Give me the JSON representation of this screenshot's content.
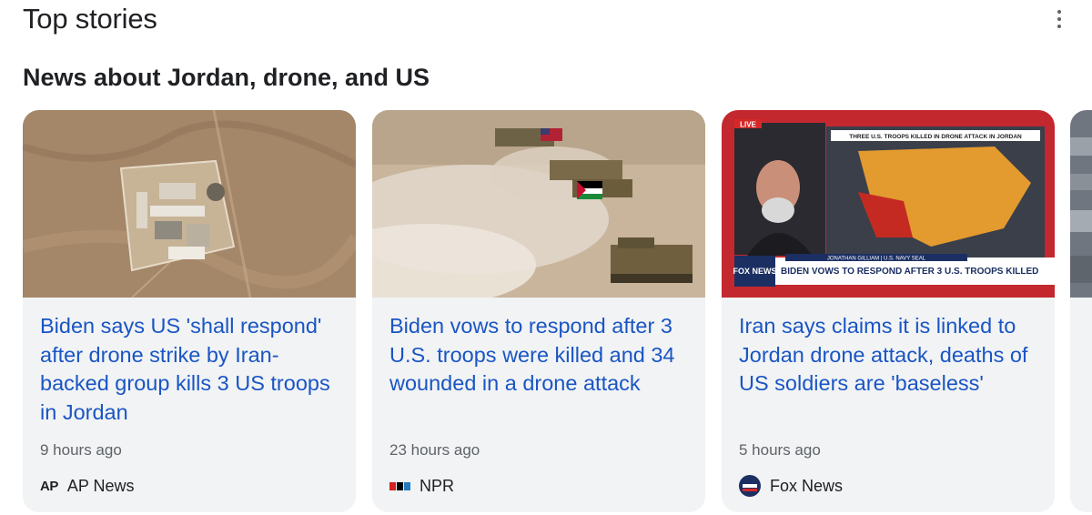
{
  "header": {
    "title": "Top stories",
    "more_icon": "more-vert-icon"
  },
  "section": {
    "title": "News about Jordan, drone, and US"
  },
  "cards": [
    {
      "headline": "Biden says US 'shall respond' after drone strike by Iran-backed group kills 3 US troops in Jordan",
      "time": "9 hours ago",
      "source": "AP News",
      "logo_text": "AP",
      "image": "satellite view of military outpost"
    },
    {
      "headline": "Biden vows to respond after 3 U.S. troops were killed and 34 wounded in a drone attack",
      "time": "23 hours ago",
      "source": "NPR",
      "logo_colors": [
        "#d62021",
        "#000000",
        "#237bbd"
      ],
      "image": "tanks with US and Jordan flags in desert"
    },
    {
      "headline": "Iran says claims it is linked to Jordan drone attack, deaths of US soldiers are 'baseless'",
      "time": "5 hours ago",
      "source": "Fox News",
      "image": "news broadcast with map",
      "broadcast": {
        "live_badge": "LIVE",
        "map_title": "THREE U.S. TROOPS KILLED IN DRONE ATTACK IN JORDAN",
        "guest_caption": "JONATHAN GILLIAM | U.S. NAVY SEAL",
        "logo_text": "FOX NEWS",
        "ticker": "BIDEN VOWS TO RESPOND AFTER 3 U.S. TROOPS KILLED"
      }
    }
  ],
  "colors": {
    "headline": "#1a55c4",
    "card_bg": "#f1f3f4",
    "meta": "#5f6368"
  }
}
